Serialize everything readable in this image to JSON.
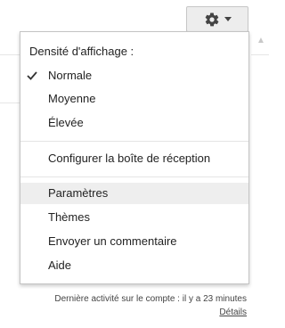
{
  "settings_button": {
    "icon": "gear-icon",
    "caret": "chevron-down-icon"
  },
  "menu": {
    "density_header": "Densité d'affichage :",
    "density_options": [
      {
        "label": "Normale",
        "checked": true
      },
      {
        "label": "Moyenne",
        "checked": false
      },
      {
        "label": "Élevée",
        "checked": false
      }
    ],
    "configure_inbox": "Configurer la boîte de réception",
    "settings": "Paramètres",
    "themes": "Thèmes",
    "send_feedback": "Envoyer un commentaire",
    "help": "Aide",
    "highlighted_item": "Paramètres"
  },
  "footer": {
    "last_activity": "Dernière activité sur le compte : il y a 23 minutes",
    "details_link": "Détails"
  },
  "colors": {
    "menu_text": "#222222",
    "highlight": "#eeeeee",
    "button_bg": "#ededed",
    "gear": "#444444"
  }
}
